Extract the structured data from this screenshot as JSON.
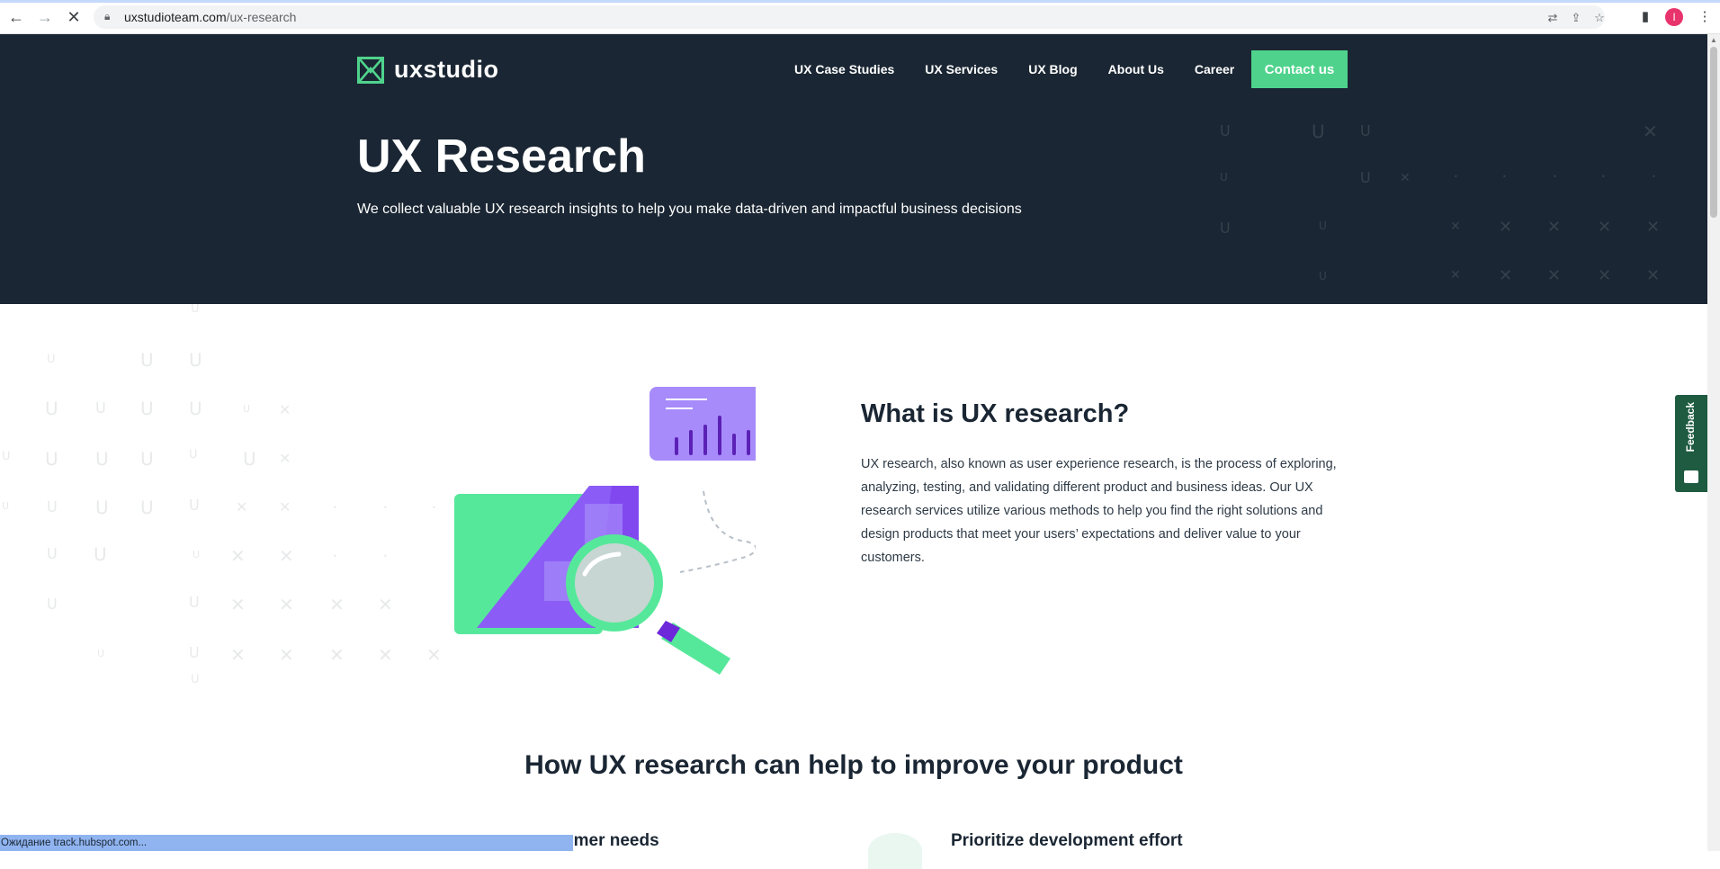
{
  "browser": {
    "url_domain": "uxstudioteam.com",
    "url_path": "/ux-research",
    "status_text": "Ожидание track.hubspot.com...",
    "avatar_letter": "I"
  },
  "site": {
    "logo_text": "uxstudio",
    "nav": [
      "UX Case Studies",
      "UX Services",
      "UX Blog",
      "About Us",
      "Career"
    ],
    "contact_label": "Contact us",
    "accent_color": "#4fd38c",
    "dark_color": "#1a2633",
    "purple_color": "#8b5cf6"
  },
  "hero": {
    "title": "UX Research",
    "subtitle": "We collect valuable UX research insights to help you make data-driven and impactful business decisions"
  },
  "what": {
    "title": "What is UX research?",
    "body": "UX research, also known as user experience research, is the process of exploring, analyzing, testing, and validating different product and business ideas. Our UX research services utilize various methods to help you find the right solutions and design products that meet your users’ expectations and deliver value to your customers."
  },
  "how": {
    "title": "How UX research can help to improve your product",
    "cards": [
      "omer needs",
      "Prioritize development effort"
    ]
  },
  "feedback_label": "Feedback"
}
